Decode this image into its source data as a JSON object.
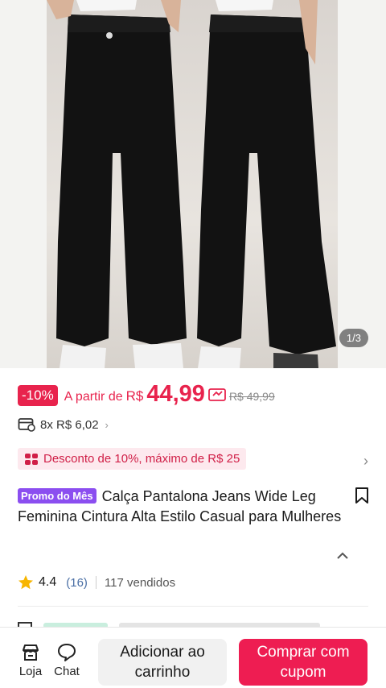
{
  "gallery": {
    "counter": "1/3"
  },
  "price": {
    "discount_badge": "-10%",
    "from_label": "A partir de",
    "currency": "R$",
    "value": "44,99",
    "old_price": "R$ 49,99"
  },
  "installments": {
    "text": "8x R$ 6,02",
    "chevron": "›"
  },
  "promo": {
    "text": "Desconto de 10%, máximo de R$ 25",
    "chevron": "›"
  },
  "product": {
    "tag": "Promo do Mês",
    "title": "Calça Pantalona Jeans Wide Leg Feminina Cintura Alta Estilo Casual para Mulheres"
  },
  "rating": {
    "score": "4.4",
    "reviews": "(16)",
    "sold": "117 vendidos"
  },
  "bottom_bar": {
    "shop_label": "Loja",
    "chat_label": "Chat",
    "add_to_cart": "Adicionar ao carrinho",
    "buy_with_coupon": "Comprar com cupom"
  },
  "colors": {
    "accent": "#ee1d52",
    "price": "#e8234d",
    "tag": "#8b4ef0",
    "star": "#f7b500"
  },
  "icons": [
    "coupon-icon",
    "card-icon",
    "ticket-icon",
    "bookmark-icon",
    "chevron-up-icon",
    "star-icon",
    "store-icon",
    "chat-icon"
  ]
}
